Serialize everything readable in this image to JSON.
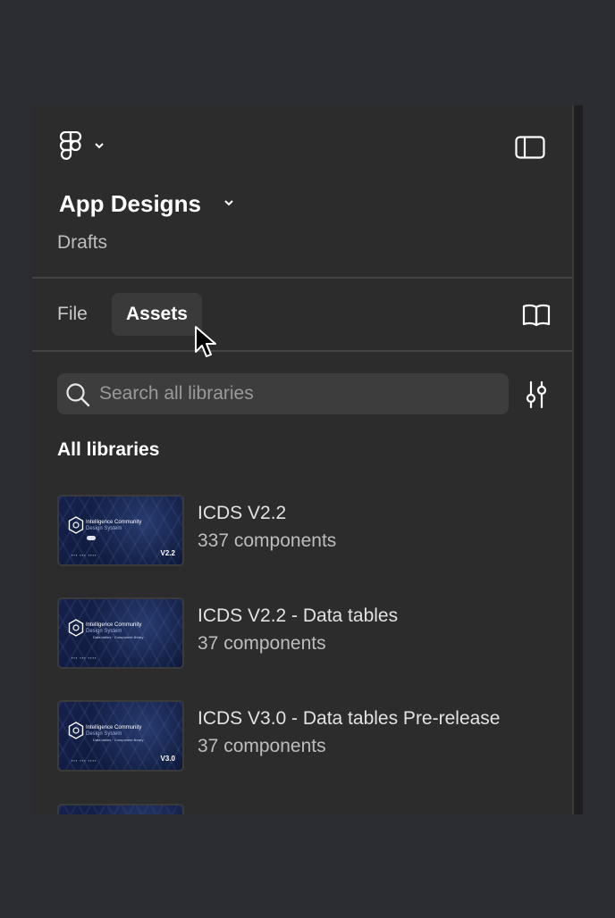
{
  "header": {
    "file_title": "App Designs",
    "file_subtitle": "Drafts"
  },
  "tabs": [
    {
      "label": "File",
      "active": false
    },
    {
      "label": "Assets",
      "active": true
    }
  ],
  "search": {
    "placeholder": "Search all libraries"
  },
  "section_heading": "All libraries",
  "libraries": [
    {
      "name": "ICDS V2.2",
      "count": "337 components",
      "thumb": {
        "brand": "Intelligence Community",
        "brand_sub": "Design System",
        "subtitle": "",
        "version": "V2.2"
      }
    },
    {
      "name": "ICDS V2.2 - Data tables",
      "count": "37 components",
      "thumb": {
        "brand": "Intelligence Community",
        "brand_sub": "Design System",
        "subtitle": "Data tables · Component library",
        "version": ""
      }
    },
    {
      "name": "ICDS V3.0 - Data tables Pre-release",
      "count": "37 components",
      "thumb": {
        "brand": "Intelligence Community",
        "brand_sub": "Design System",
        "subtitle": "Data tables · Component library",
        "version": "V3.0"
      }
    }
  ],
  "colors": {
    "page_bg": "#2b2d33",
    "panel_bg": "#2c2c2c",
    "active_tab_bg": "#3a3a3a",
    "search_bg": "#3d3d3d",
    "thumbnail_bg": "#0f1a3a"
  },
  "icons": [
    "figma-logo-icon",
    "chevron-down-icon",
    "sidebar-toggle-icon",
    "library-book-icon",
    "search-icon",
    "filter-sliders-icon",
    "cursor-pointer-icon"
  ]
}
